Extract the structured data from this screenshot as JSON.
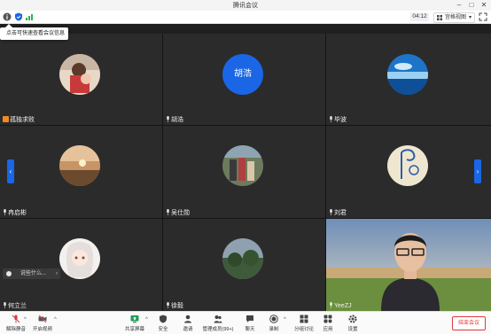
{
  "window": {
    "title": "腾讯会议"
  },
  "toolbar": {
    "timer": "04:12",
    "view_label": "宫格视图"
  },
  "tooltip": {
    "text": "点击可快速查看会议信息"
  },
  "participants": [
    {
      "name": "孤独求败"
    },
    {
      "name": "胡浩",
      "avatar_text": "胡浩"
    },
    {
      "name": "毕波"
    },
    {
      "name": "冉启彬"
    },
    {
      "name": "吴仕勋"
    },
    {
      "name": "刘君"
    },
    {
      "name": "何立兰"
    },
    {
      "name": "徐毅"
    },
    {
      "name": "YeeZJ"
    }
  ],
  "caption": {
    "text": "说些什么..."
  },
  "bottombar": {
    "mute_label": "解除静音",
    "video_label": "开启视频",
    "share_label": "共享屏幕",
    "security_label": "安全",
    "invite_label": "邀请",
    "members_label": "管理成员(99+)",
    "chat_label": "聊天",
    "record_label": "录制",
    "breakout_label": "分组讨论",
    "apps_label": "应用",
    "settings_label": "设置",
    "end_label": "结束会议"
  },
  "colors": {
    "accent": "#1a66e6",
    "end": "#e0393e",
    "host": "#f08a24"
  }
}
